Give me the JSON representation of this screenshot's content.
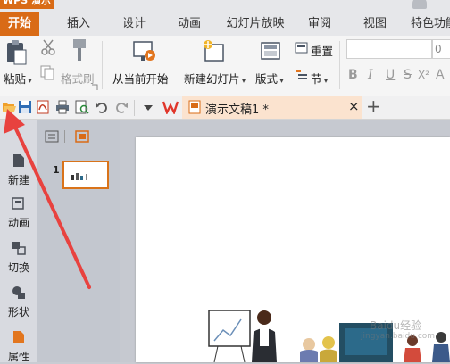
{
  "app": {
    "name": "WPS 演示",
    "faint_title_1": "",
    "faint_title_2": ""
  },
  "tabs": [
    {
      "label": "开始",
      "active": true
    },
    {
      "label": "插入"
    },
    {
      "label": "设计"
    },
    {
      "label": "动画"
    },
    {
      "label": "幻灯片放映"
    },
    {
      "label": "审阅"
    },
    {
      "label": "视图"
    },
    {
      "label": "特色功能"
    }
  ],
  "ribbon": {
    "paste": "粘贴",
    "format_painter": "格式刷",
    "from_current": "从当前开始",
    "new_slide": "新建幻灯片",
    "layout": "版式",
    "reset": "重置",
    "section": "节",
    "font_size": "0",
    "bold": "B",
    "italic": "I",
    "underline": "U",
    "strike": "S",
    "superscript": "X²",
    "font_color": "A"
  },
  "document": {
    "tab_title": "演示文稿1 *",
    "close": "×",
    "new_tab": "+"
  },
  "sidebar": {
    "items": [
      {
        "label": "新建"
      },
      {
        "label": "动画"
      },
      {
        "label": "切换"
      },
      {
        "label": "形状"
      },
      {
        "label": "属性"
      }
    ]
  },
  "thumbnails": {
    "slide_number": "1"
  },
  "watermark": {
    "text": "Baidu经验",
    "url": "jingyan.baidu.com"
  },
  "colors": {
    "accent": "#d96b16",
    "annotation_arrow": "#e8423f"
  }
}
